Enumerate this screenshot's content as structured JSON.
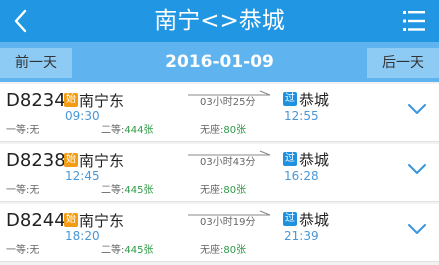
{
  "header": {
    "title": "南宁<>恭城",
    "back_icon": "chevron-left-icon",
    "menu_icon": "hamburger-menu-icon",
    "color": "#2196e3"
  },
  "datebar": {
    "prev_label": "前一天",
    "date": "2016-01-09",
    "next_label": "后一天",
    "color": "#5fb3ee"
  },
  "trains": [
    {
      "train_no": "D8234",
      "start_badge": "始",
      "from": "南宁东",
      "dep_time": "09:30",
      "duration": "03小时25分",
      "pass_badge": "过",
      "to": "恭城",
      "arr_time": "12:55",
      "seat1_label": "一等:",
      "seat1_value": "无",
      "seat2_label": "二等:",
      "seat2_value": "444张",
      "seat3_label": "无座:",
      "seat3_value": "80张"
    },
    {
      "train_no": "D8238",
      "start_badge": "始",
      "from": "南宁东",
      "dep_time": "12:45",
      "duration": "03小时43分",
      "pass_badge": "过",
      "to": "恭城",
      "arr_time": "16:28",
      "seat1_label": "一等:",
      "seat1_value": "无",
      "seat2_label": "二等:",
      "seat2_value": "445张",
      "seat3_label": "无座:",
      "seat3_value": "80张"
    },
    {
      "train_no": "D8244",
      "start_badge": "始",
      "from": "南宁东",
      "dep_time": "18:20",
      "duration": "03小时19分",
      "pass_badge": "过",
      "to": "恭城",
      "arr_time": "21:39",
      "seat1_label": "一等:",
      "seat1_value": "无",
      "seat2_label": "二等:",
      "seat2_value": "445张",
      "seat3_label": "无座:",
      "seat3_value": "80张"
    }
  ]
}
